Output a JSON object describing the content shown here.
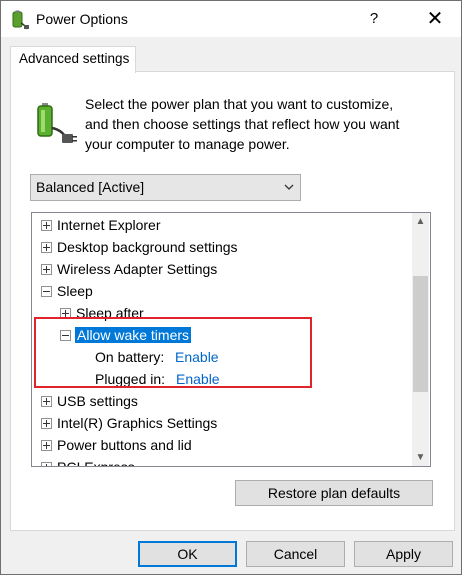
{
  "window": {
    "title": "Power Options",
    "help_label": "?",
    "close_label": "✕"
  },
  "tab": {
    "label": "Advanced settings"
  },
  "description": {
    "line1": "Select the power plan that you want to customize,",
    "line2": "and then choose settings that reflect how you want",
    "line3": "your computer to manage power."
  },
  "plan_select": {
    "selected": "Balanced [Active]"
  },
  "tree": {
    "items": [
      {
        "label": "Internet Explorer",
        "expander": "+"
      },
      {
        "label": "Desktop background settings",
        "expander": "+"
      },
      {
        "label": "Wireless Adapter Settings",
        "expander": "+"
      },
      {
        "label": "Sleep",
        "expander": "-"
      },
      {
        "label": "Sleep after",
        "expander": "+"
      },
      {
        "label": "Allow wake timers",
        "expander": "-"
      },
      {
        "label": "On battery:",
        "value": "Enable"
      },
      {
        "label": "Plugged in:",
        "value": "Enable"
      },
      {
        "label": "USB settings",
        "expander": "+"
      },
      {
        "label": "Intel(R) Graphics Settings",
        "expander": "+"
      },
      {
        "label": "Power buttons and lid",
        "expander": "+"
      },
      {
        "label": "PCI Express",
        "expander": "+"
      }
    ]
  },
  "buttons": {
    "restore": "Restore plan defaults",
    "ok": "OK",
    "cancel": "Cancel",
    "apply": "Apply"
  },
  "colors": {
    "selection": "#0078d7",
    "link": "#0066cc",
    "highlight_box": "#e0242a"
  }
}
